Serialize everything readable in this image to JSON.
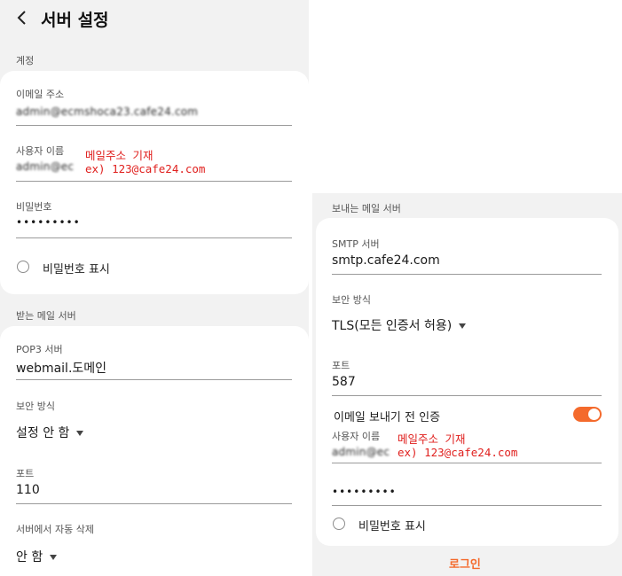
{
  "header": {
    "title": "서버 설정",
    "back_icon": "back-arrow-icon"
  },
  "account": {
    "section_label": "계정",
    "email_label": "이메일 주소",
    "email_value": "admin@ecmshoca23.cafe24.com",
    "username_label": "사용자 이름",
    "username_value": "admin@ec",
    "username_note_1": "메일주소 기재",
    "username_note_2": "ex) 123@cafe24.com",
    "password_label": "비밀번호",
    "password_value": "•••••••••",
    "show_password_label": "비밀번호 표시"
  },
  "incoming": {
    "section_label": "받는 메일 서버",
    "server_label": "POP3 서버",
    "server_value": "webmail.도메인",
    "security_label": "보안 방식",
    "security_value": "설정 안 함",
    "port_label": "포트",
    "port_value": "110",
    "delete_label": "서버에서 자동 삭제",
    "delete_value": "안 함"
  },
  "outgoing": {
    "section_label": "보내는 메일 서버",
    "server_label": "SMTP 서버",
    "server_value": "smtp.cafe24.com",
    "security_label": "보안 방식",
    "security_value": "TLS(모든 인증서 허용)",
    "port_label": "포트",
    "port_value": "587",
    "auth_label": "이메일 보내기 전 인증",
    "auth_enabled": true,
    "username_label": "사용자 이름",
    "username_value": "admin@ec",
    "username_note_1": "메일주소 기재",
    "username_note_2": "ex) 123@cafe24.com",
    "password_value": "•••••••••",
    "show_password_label": "비밀번호 표시"
  },
  "login_button": "로그인",
  "colors": {
    "accent": "#f46a2c",
    "note": "#e0201e",
    "background": "#f2f2f2"
  }
}
